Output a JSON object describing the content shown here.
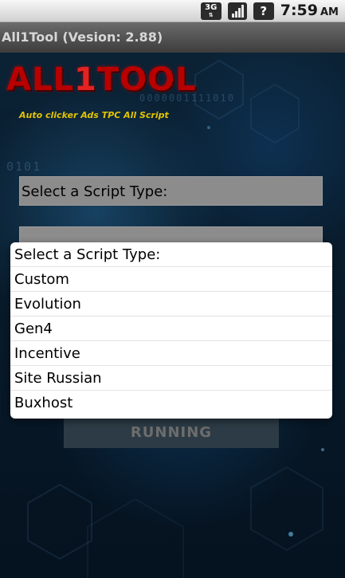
{
  "status_bar": {
    "network_type": "3G",
    "time": "7:59",
    "ampm": "AM"
  },
  "app": {
    "title": "All1Tool (Vesion: 2.88)",
    "logo": {
      "left": "ALL",
      "middle": "1",
      "right": "TOOL"
    },
    "tagline": "Auto clicker Ads TPC All Script",
    "background_text": {
      "top": "0000001111010",
      "side": "0101"
    }
  },
  "form": {
    "script_type_label": "Select a Script Type:",
    "running_label": "RUNNING"
  },
  "dropdown": {
    "header": "Select a Script Type:",
    "options": [
      "Custom",
      "Evolution",
      "Gen4",
      "Incentive",
      "Site Russian",
      "Buxhost"
    ]
  },
  "colors": {
    "logo_red": "#b80000",
    "tagline_yellow": "#e3c300",
    "field_gray": "#8c8c8c",
    "dropdown_white": "#ffffff"
  },
  "icons": {
    "network": "3g-network-icon",
    "signal": "signal-strength-icon",
    "sim": "missing-sim-icon"
  }
}
